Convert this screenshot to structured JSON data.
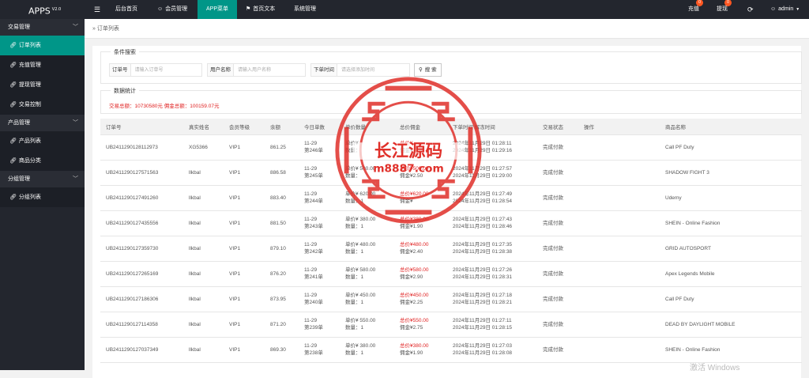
{
  "app": {
    "title": "APPS",
    "version": "V2.0"
  },
  "nav": {
    "toggle_icon": "menu-icon",
    "items": [
      {
        "label": "后台首页"
      },
      {
        "label": "会员管理"
      },
      {
        "label": "APP菜单"
      },
      {
        "label": "首页文本"
      },
      {
        "label": "系统管理"
      }
    ],
    "recharge": {
      "label": "充值",
      "badge": "0"
    },
    "withdraw": {
      "label": "提现",
      "badge": "0"
    },
    "refresh_icon": "refresh-icon",
    "user": "admin"
  },
  "sidebar": {
    "groups": [
      {
        "label": "交易管理",
        "items": [
          {
            "label": "订单列表"
          },
          {
            "label": "充值管理"
          },
          {
            "label": "提现管理"
          },
          {
            "label": "交易控制"
          }
        ]
      },
      {
        "label": "产品管理",
        "items": [
          {
            "label": "产品列表"
          },
          {
            "label": "商品分类"
          }
        ]
      },
      {
        "label": "分组管理",
        "items": [
          {
            "label": "分组列表"
          }
        ]
      }
    ]
  },
  "breadcrumb": "»  订单列表",
  "search": {
    "legend": "条件搜索",
    "order_no_label": "订单号",
    "order_no_placeholder": "请输入订单号",
    "username_label": "用户名称",
    "username_placeholder": "请输入用户名称",
    "time_label": "下单时间",
    "time_placeholder": "请选择添加时间",
    "button": "搜 索"
  },
  "stats": {
    "legend": "数据统计",
    "text": "交易总额：10730580元    佣金总额：100159.07元"
  },
  "table": {
    "headers": [
      "订单号",
      "真实姓名",
      "会员等级",
      "余额",
      "今日单数",
      "单价数量",
      "总价佣金",
      "下单时间 解冻时间",
      "交易状态",
      "操作",
      "商品名称"
    ],
    "rows": [
      {
        "order": "UB2411290128112973",
        "name": "XG5366",
        "level": "VIP1",
        "balance": "861.25",
        "date": "11-29",
        "count": "第246单",
        "price": "单价¥",
        "qty": "数量：",
        "total": "总价¥",
        "comm": "佣金¥",
        "t1": "2024年11月29日 01:28:11",
        "t2": "2024年11月29日 01:29:16",
        "status": "完成付款",
        "op": "",
        "product": "Call PF Duty"
      },
      {
        "order": "UB2411290127571563",
        "name": "llkbal",
        "level": "VIP1",
        "balance": "886.58",
        "date": "11-29",
        "count": "第245单",
        "price": "单价¥  500.00",
        "qty": "数量：",
        "total": "总价¥500.00",
        "comm": "佣金¥2.50",
        "t1": "2024年11月29日 01:27:57",
        "t2": "2024年11月29日 01:29:00",
        "status": "完成付款",
        "op": "",
        "product": "SHADOW FIGHT 3"
      },
      {
        "order": "UB2411290127491260",
        "name": "llkbal",
        "level": "VIP1",
        "balance": "883.40",
        "date": "11-29",
        "count": "第244单",
        "price": "单价¥  620.00",
        "qty": "数量：1",
        "total": "总价¥620.00",
        "comm": "佣金¥",
        "t1": "2024年11月29日 01:27:49",
        "t2": "2024年11月29日 01:28:54",
        "status": "完成付款",
        "op": "",
        "product": "Udemy"
      },
      {
        "order": "UB2411290127435556",
        "name": "llkbal",
        "level": "VIP1",
        "balance": "881.50",
        "date": "11-29",
        "count": "第243单",
        "price": "单价¥  380.00",
        "qty": "数量：1",
        "total": "总价¥380.00",
        "comm": "佣金¥1.90",
        "t1": "2024年11月29日 01:27:43",
        "t2": "2024年11月29日 01:28:46",
        "status": "完成付款",
        "op": "",
        "product": "SHEIN - Online Fashion"
      },
      {
        "order": "UB2411290127359730",
        "name": "llkbal",
        "level": "VIP1",
        "balance": "879.10",
        "date": "11-29",
        "count": "第242单",
        "price": "单价¥  480.00",
        "qty": "数量：1",
        "total": "总价¥480.00",
        "comm": "佣金¥2.40",
        "t1": "2024年11月29日 01:27:35",
        "t2": "2024年11月29日 01:28:38",
        "status": "完成付款",
        "op": "",
        "product": "GRID AUTOSPORT"
      },
      {
        "order": "UB2411290127265169",
        "name": "llkbal",
        "level": "VIP1",
        "balance": "876.20",
        "date": "11-29",
        "count": "第241单",
        "price": "单价¥  580.00",
        "qty": "数量：1",
        "total": "总价¥580.00",
        "comm": "佣金¥2.90",
        "t1": "2024年11月29日 01:27:26",
        "t2": "2024年11月29日 01:28:31",
        "status": "完成付款",
        "op": "",
        "product": "Apex Legends Mobile"
      },
      {
        "order": "UB2411290127186306",
        "name": "llkbal",
        "level": "VIP1",
        "balance": "873.95",
        "date": "11-29",
        "count": "第240单",
        "price": "单价¥  450.00",
        "qty": "数量：1",
        "total": "总价¥450.00",
        "comm": "佣金¥2.25",
        "t1": "2024年11月29日 01:27:18",
        "t2": "2024年11月29日 01:28:21",
        "status": "完成付款",
        "op": "",
        "product": "Call PF Duty"
      },
      {
        "order": "UB2411290127114358",
        "name": "llkbal",
        "level": "VIP1",
        "balance": "871.20",
        "date": "11-29",
        "count": "第239单",
        "price": "单价¥  550.00",
        "qty": "数量：1",
        "total": "总价¥550.00",
        "comm": "佣金¥2.75",
        "t1": "2024年11月29日 01:27:11",
        "t2": "2024年11月29日 01:28:15",
        "status": "完成付款",
        "op": "",
        "product": "DEAD BY DAYLIGHT MOBILE"
      },
      {
        "order": "UB2411290127037349",
        "name": "llkbal",
        "level": "VIP1",
        "balance": "869.30",
        "date": "11-29",
        "count": "第238单",
        "price": "单价¥  380.00",
        "qty": "数量：1",
        "total": "总价¥380.00",
        "comm": "佣金¥1.90",
        "t1": "2024年11月29日 01:27:03",
        "t2": "2024年11月29日 01:28:08",
        "status": "完成付款",
        "op": "",
        "product": "SHEIN - Online Fashion"
      }
    ]
  },
  "watermark": {
    "title": "长江源码",
    "url": "m8887.com"
  },
  "os_watermark": "激活 Windows",
  "colors": {
    "accent": "#009688",
    "dark": "#23262e",
    "red": "#e02020",
    "badge": "#ff5722"
  }
}
